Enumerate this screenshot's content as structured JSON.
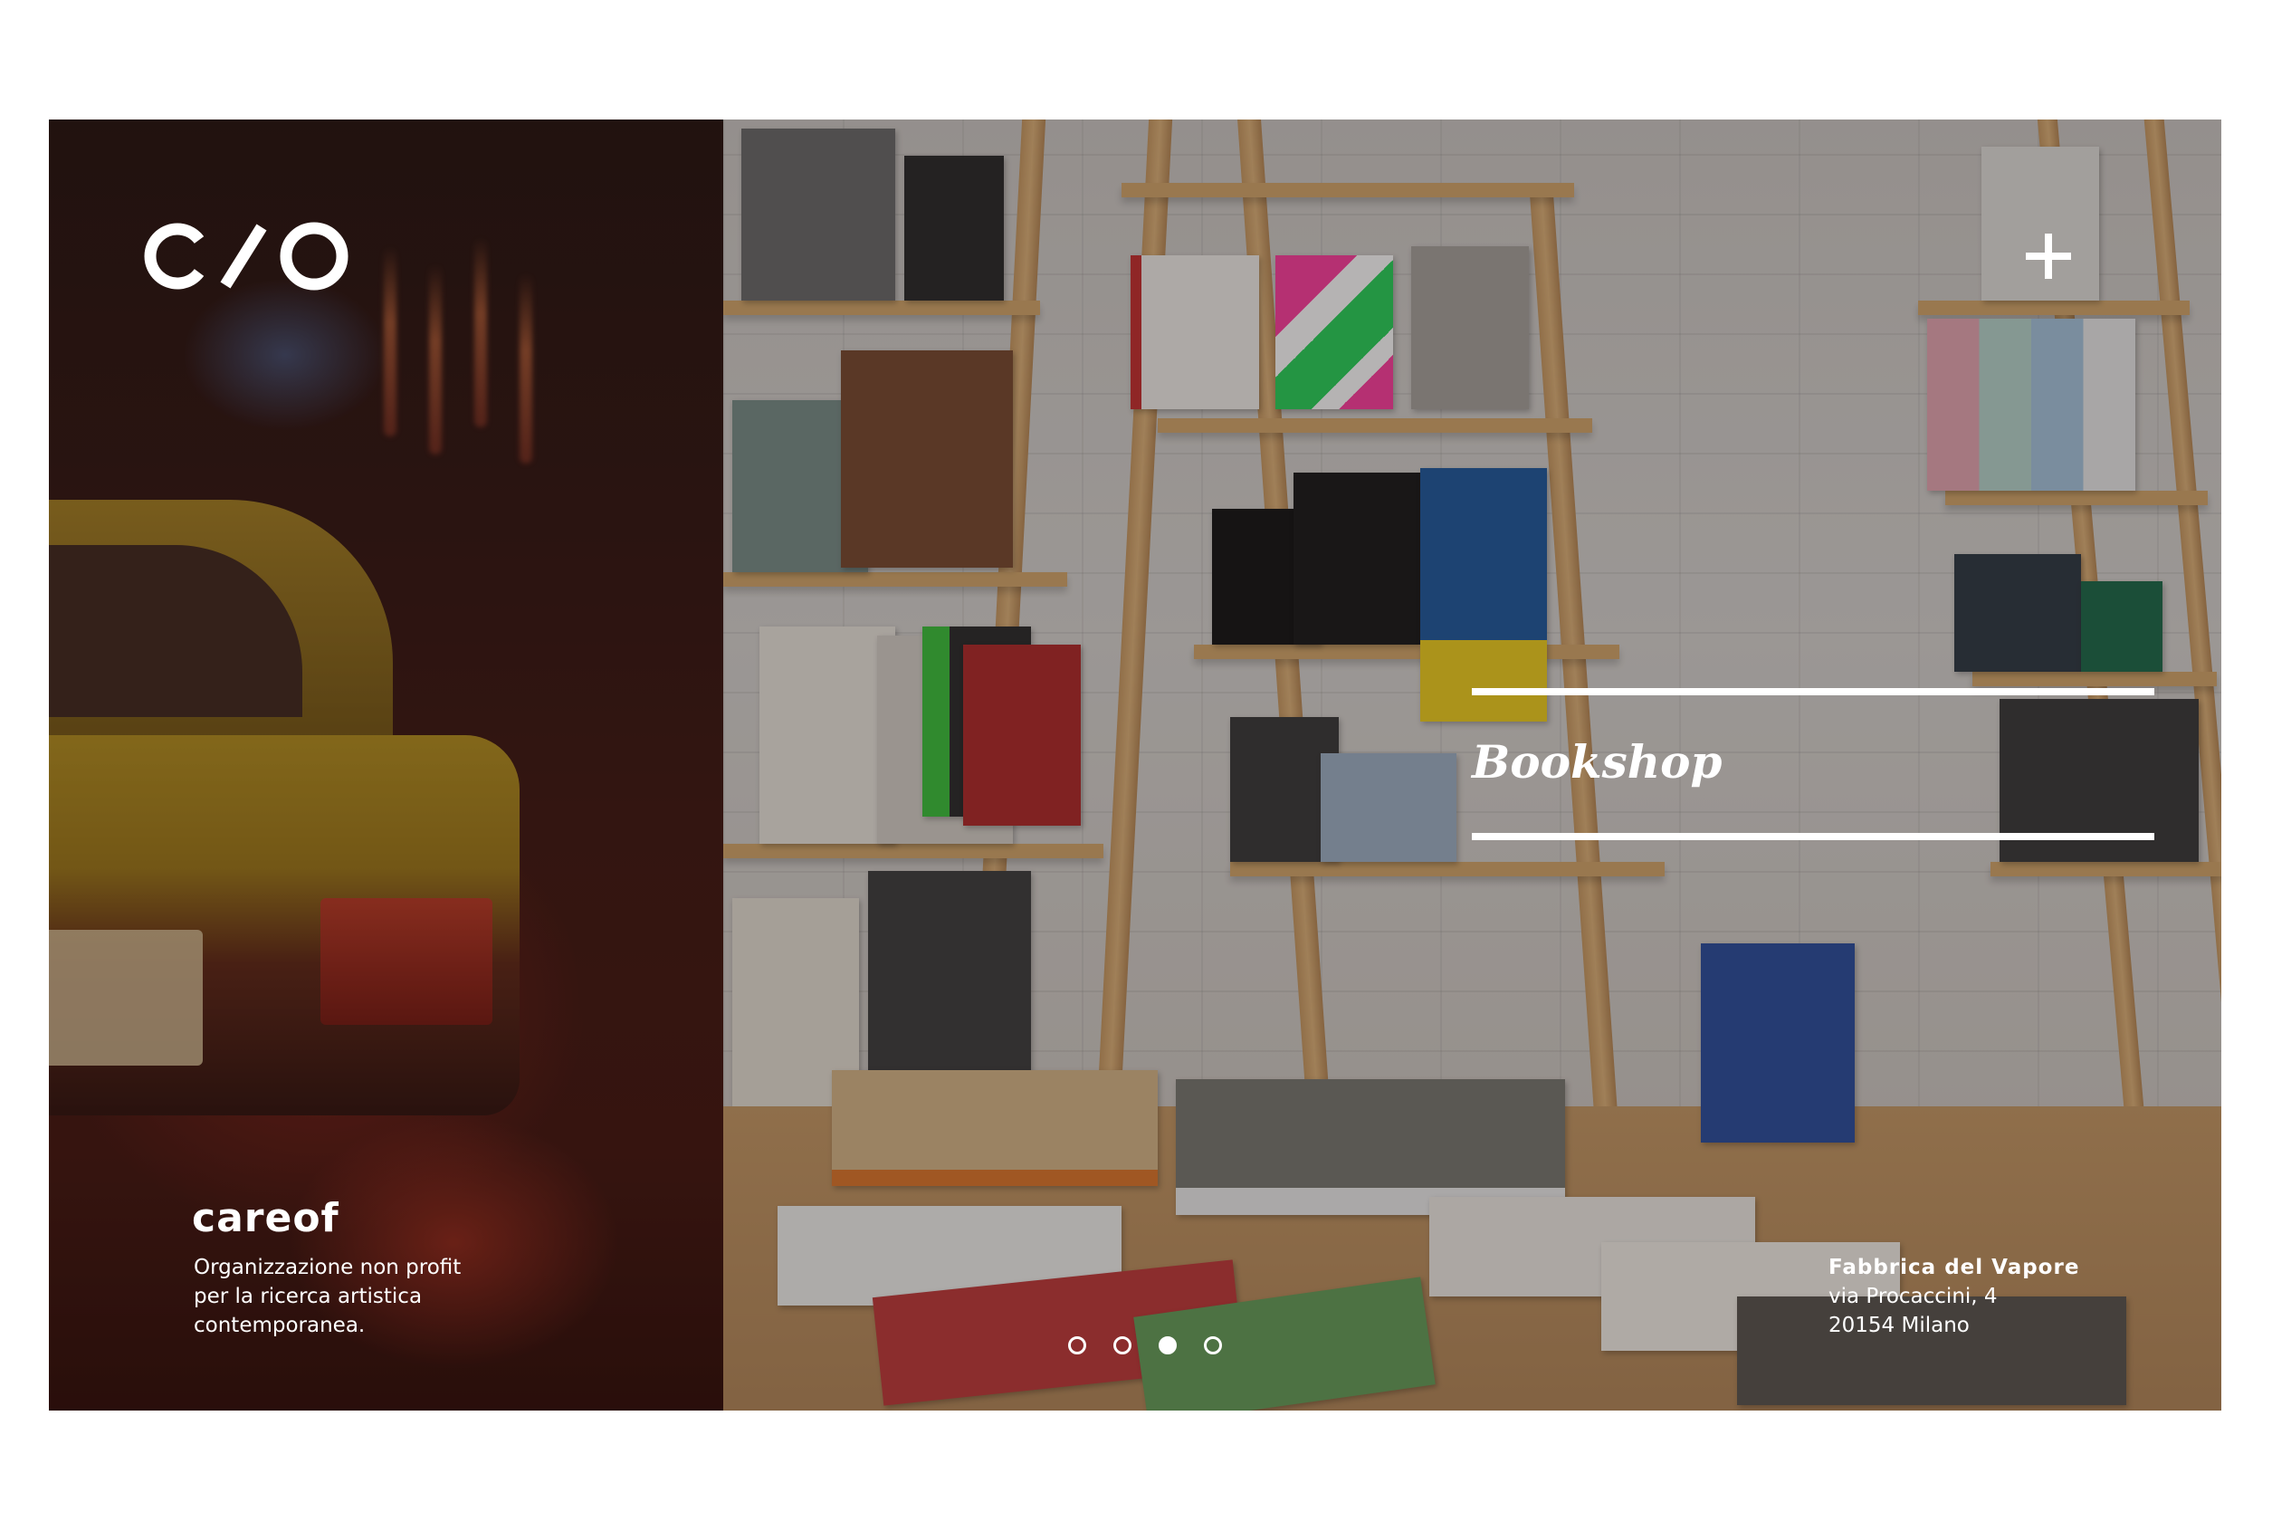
{
  "brand": {
    "logo_icon": "c-slash-o-logo",
    "name": "careof",
    "description_lines": [
      "Organizzazione non profit",
      "per la ricerca artistica",
      "contemporanea."
    ]
  },
  "header": {
    "menu_icon": "plus-icon"
  },
  "hero": {
    "section_title": "Bookshop"
  },
  "address": {
    "venue": "Fabbrica del Vapore",
    "street": "via Procaccini, 4",
    "city": "20154 Milano"
  },
  "slider": {
    "total": 4,
    "active_index": 2,
    "dots": [
      "slide-1",
      "slide-2",
      "slide-3",
      "slide-4"
    ]
  },
  "colors": {
    "overlay_text": "#ffffff",
    "page_background": "#ffffff"
  }
}
